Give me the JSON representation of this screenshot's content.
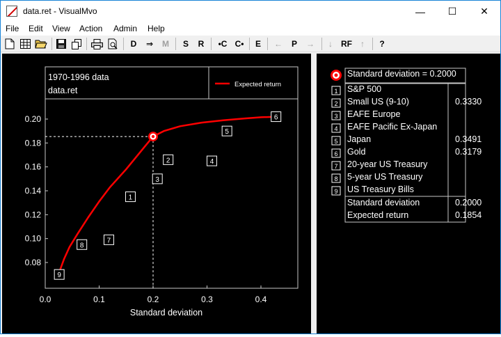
{
  "window": {
    "title": "data.ret - VisualMvo",
    "minimize_glyph": "—",
    "maximize_glyph": "☐",
    "close_glyph": "✕"
  },
  "menu": [
    "File",
    "Edit",
    "View",
    "Action",
    "Admin",
    "Help"
  ],
  "toolbar": {
    "text_buttons": [
      {
        "label": "D",
        "enabled": true
      },
      {
        "label": "⇒",
        "enabled": true
      },
      {
        "label": "M",
        "enabled": false
      },
      {
        "label": "S",
        "enabled": true
      },
      {
        "label": "R",
        "enabled": true
      },
      {
        "label": "•C",
        "enabled": true
      },
      {
        "label": "C•",
        "enabled": true
      },
      {
        "label": "E",
        "enabled": true
      },
      {
        "label": "←",
        "enabled": false
      },
      {
        "label": "P",
        "enabled": true
      },
      {
        "label": "→",
        "enabled": false
      },
      {
        "label": "↓",
        "enabled": false
      },
      {
        "label": "RF",
        "enabled": true
      },
      {
        "label": "↑",
        "enabled": false
      },
      {
        "label": "?",
        "enabled": true
      }
    ],
    "icons": [
      "new-file-icon",
      "grid-icon",
      "open-folder-icon",
      "save-icon",
      "copy-icon",
      "print-icon",
      "print-preview-icon"
    ]
  },
  "chart_data": {
    "type": "line",
    "info_lines": [
      "1970-1996 data",
      "data.ret"
    ],
    "legend": "Expected return",
    "xlabel": "Standard deviation",
    "ylabel": "",
    "xlim": [
      0.0,
      0.45
    ],
    "ylim": [
      0.06,
      0.21
    ],
    "xticks": [
      0.0,
      0.1,
      0.2,
      0.3,
      0.4
    ],
    "xtick_labels": [
      "0.0",
      "0.1",
      "0.2",
      "0.3",
      "0.4"
    ],
    "yticks": [
      0.08,
      0.1,
      0.12,
      0.14,
      0.16,
      0.18,
      0.2
    ],
    "ytick_labels": [
      "0.08",
      "0.10",
      "0.12",
      "0.14",
      "0.16",
      "0.18",
      "0.20"
    ],
    "frontier": {
      "name": "Expected return",
      "color": "#ff0000",
      "x": [
        0.026,
        0.035,
        0.045,
        0.06,
        0.08,
        0.1,
        0.12,
        0.15,
        0.17,
        0.19,
        0.2,
        0.22,
        0.25,
        0.29,
        0.33,
        0.37,
        0.4,
        0.43
      ],
      "y": [
        0.072,
        0.083,
        0.093,
        0.104,
        0.118,
        0.131,
        0.143,
        0.158,
        0.169,
        0.18,
        0.1854,
        0.19,
        0.194,
        0.197,
        0.199,
        0.2005,
        0.2015,
        0.202
      ]
    },
    "assets": [
      {
        "id": "1",
        "x": 0.158,
        "y": 0.135
      },
      {
        "id": "2",
        "x": 0.228,
        "y": 0.166
      },
      {
        "id": "3",
        "x": 0.208,
        "y": 0.15
      },
      {
        "id": "4",
        "x": 0.309,
        "y": 0.165
      },
      {
        "id": "5",
        "x": 0.337,
        "y": 0.19
      },
      {
        "id": "6",
        "x": 0.428,
        "y": 0.202
      },
      {
        "id": "7",
        "x": 0.118,
        "y": 0.099
      },
      {
        "id": "8",
        "x": 0.068,
        "y": 0.095
      },
      {
        "id": "9",
        "x": 0.026,
        "y": 0.07
      }
    ],
    "selected_point": {
      "x": 0.2,
      "y": 0.1854
    }
  },
  "side_panel": {
    "header": "Standard deviation = 0.2000",
    "rows": [
      {
        "num": "1",
        "name": "S&P 500",
        "value": ""
      },
      {
        "num": "2",
        "name": "Small US (9-10)",
        "value": "0.3330"
      },
      {
        "num": "3",
        "name": "EAFE Europe",
        "value": ""
      },
      {
        "num": "4",
        "name": "EAFE Pacific Ex-Japan",
        "value": ""
      },
      {
        "num": "5",
        "name": "Japan",
        "value": "0.3491"
      },
      {
        "num": "6",
        "name": "Gold",
        "value": "0.3179"
      },
      {
        "num": "7",
        "name": "20-year US Treasury",
        "value": ""
      },
      {
        "num": "8",
        "name": "5-year US Treasury",
        "value": ""
      },
      {
        "num": "9",
        "name": "US Treasury Bills",
        "value": ""
      }
    ],
    "summary": [
      {
        "name": "Standard deviation",
        "value": "0.2000"
      },
      {
        "name": "Expected return",
        "value": "0.1854"
      }
    ]
  }
}
